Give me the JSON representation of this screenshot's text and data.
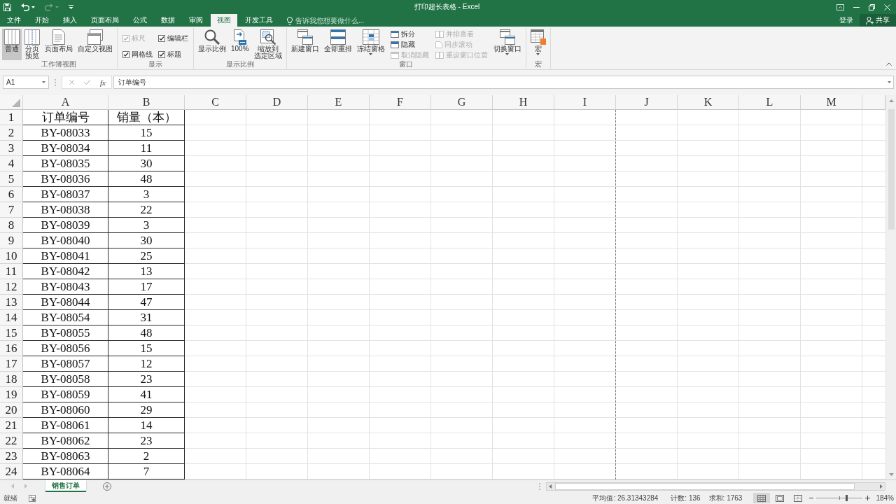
{
  "window": {
    "title": "打印超长表格 - Excel",
    "sign_in": "登录",
    "share": "共享"
  },
  "ribbon_tabs": [
    {
      "label": "文件",
      "selected": false
    },
    {
      "label": "开始",
      "selected": false
    },
    {
      "label": "插入",
      "selected": false
    },
    {
      "label": "页面布局",
      "selected": false
    },
    {
      "label": "公式",
      "selected": false
    },
    {
      "label": "数据",
      "selected": false
    },
    {
      "label": "审阅",
      "selected": false
    },
    {
      "label": "视图",
      "selected": true
    },
    {
      "label": "开发工具",
      "selected": false
    }
  ],
  "tell_me": {
    "placeholder": "告诉我您想要做什么..."
  },
  "ribbon": {
    "groups": [
      {
        "label": "工作簿视图",
        "items": [
          {
            "kind": "large",
            "label": "普通",
            "selected": true,
            "dropdown": false
          },
          {
            "kind": "large",
            "label": "分页预览",
            "selected": false,
            "dropdown": false
          },
          {
            "kind": "large",
            "label": "页面布局",
            "selected": false,
            "dropdown": false
          },
          {
            "kind": "large",
            "label": "自定义视图",
            "selected": false,
            "dropdown": false
          }
        ]
      },
      {
        "label": "显示",
        "items": [
          {
            "kind": "check",
            "label": "标尺",
            "checked": true,
            "disabled": true
          },
          {
            "kind": "check",
            "label": "编辑栏",
            "checked": true,
            "disabled": false
          },
          {
            "kind": "check",
            "label": "网格线",
            "checked": true,
            "disabled": false
          },
          {
            "kind": "check",
            "label": "标题",
            "checked": true,
            "disabled": false
          }
        ]
      },
      {
        "label": "显示比例",
        "items": [
          {
            "kind": "large",
            "label": "显示比例",
            "dropdown": false
          },
          {
            "kind": "large",
            "label": "100%",
            "dropdown": false
          },
          {
            "kind": "large",
            "label": "缩放到选定区域",
            "dropdown": false
          }
        ]
      },
      {
        "label": "窗口",
        "items": [
          {
            "kind": "large",
            "label": "新建窗口",
            "dropdown": false
          },
          {
            "kind": "large",
            "label": "全部重排",
            "dropdown": false
          },
          {
            "kind": "large",
            "label": "冻结窗格",
            "dropdown": true
          },
          {
            "kind": "small",
            "label": "拆分",
            "disabled": false
          },
          {
            "kind": "small",
            "label": "隐藏",
            "disabled": false
          },
          {
            "kind": "small",
            "label": "取消隐藏",
            "disabled": true
          },
          {
            "kind": "small",
            "label": "并排查看",
            "disabled": true
          },
          {
            "kind": "small",
            "label": "同步滚动",
            "disabled": true
          },
          {
            "kind": "small",
            "label": "重设窗口位置",
            "disabled": true
          },
          {
            "kind": "large",
            "label": "切换窗口",
            "dropdown": true
          }
        ]
      },
      {
        "label": "宏",
        "items": [
          {
            "kind": "large",
            "label": "宏",
            "dropdown": true
          }
        ]
      }
    ]
  },
  "formula_bar": {
    "name_box": "A1",
    "function_label": "fx",
    "formula": "订单编号"
  },
  "sheet": {
    "columns": [
      {
        "label": "A",
        "page_break": false
      },
      {
        "label": "B",
        "page_break": false
      },
      {
        "label": "C",
        "page_break": false
      },
      {
        "label": "D",
        "page_break": false
      },
      {
        "label": "E",
        "page_break": false
      },
      {
        "label": "F",
        "page_break": false
      },
      {
        "label": "G",
        "page_break": false
      },
      {
        "label": "H",
        "page_break": false
      },
      {
        "label": "I",
        "page_break": true
      },
      {
        "label": "J",
        "page_break": false
      },
      {
        "label": "K",
        "page_break": false
      },
      {
        "label": "L",
        "page_break": false
      },
      {
        "label": "M",
        "page_break": false
      }
    ],
    "rows": [
      {
        "number": "1",
        "cells": [
          "订单编号",
          "销量（本）"
        ]
      },
      {
        "number": "2",
        "cells": [
          "BY-08033",
          "15"
        ]
      },
      {
        "number": "3",
        "cells": [
          "BY-08034",
          "11"
        ]
      },
      {
        "number": "4",
        "cells": [
          "BY-08035",
          "30"
        ]
      },
      {
        "number": "5",
        "cells": [
          "BY-08036",
          "48"
        ]
      },
      {
        "number": "6",
        "cells": [
          "BY-08037",
          "3"
        ]
      },
      {
        "number": "7",
        "cells": [
          "BY-08038",
          "22"
        ]
      },
      {
        "number": "8",
        "cells": [
          "BY-08039",
          "3"
        ]
      },
      {
        "number": "9",
        "cells": [
          "BY-08040",
          "30"
        ]
      },
      {
        "number": "10",
        "cells": [
          "BY-08041",
          "25"
        ]
      },
      {
        "number": "11",
        "cells": [
          "BY-08042",
          "13"
        ]
      },
      {
        "number": "12",
        "cells": [
          "BY-08043",
          "17"
        ]
      },
      {
        "number": "13",
        "cells": [
          "BY-08044",
          "47"
        ]
      },
      {
        "number": "14",
        "cells": [
          "BY-08054",
          "31"
        ]
      },
      {
        "number": "15",
        "cells": [
          "BY-08055",
          "48"
        ]
      },
      {
        "number": "16",
        "cells": [
          "BY-08056",
          "15"
        ]
      },
      {
        "number": "17",
        "cells": [
          "BY-08057",
          "12"
        ]
      },
      {
        "number": "18",
        "cells": [
          "BY-08058",
          "23"
        ]
      },
      {
        "number": "19",
        "cells": [
          "BY-08059",
          "41"
        ]
      },
      {
        "number": "20",
        "cells": [
          "BY-08060",
          "29"
        ]
      },
      {
        "number": "21",
        "cells": [
          "BY-08061",
          "14"
        ]
      },
      {
        "number": "22",
        "cells": [
          "BY-08062",
          "23"
        ]
      },
      {
        "number": "23",
        "cells": [
          "BY-08063",
          "2"
        ]
      },
      {
        "number": "24",
        "cells": [
          "BY-08064",
          "7"
        ]
      }
    ]
  },
  "sheet_tabs": [
    {
      "label": "销售订单",
      "selected": true
    }
  ],
  "status_bar": {
    "mode": "就绪",
    "average": "平均值: 26.31343284",
    "count": "计数: 136",
    "sum": "求和: 1763",
    "views": [
      {
        "selected": true
      },
      {
        "selected": false
      },
      {
        "selected": false
      }
    ],
    "zoom": {
      "level": 0.64,
      "reading": "184%"
    }
  }
}
